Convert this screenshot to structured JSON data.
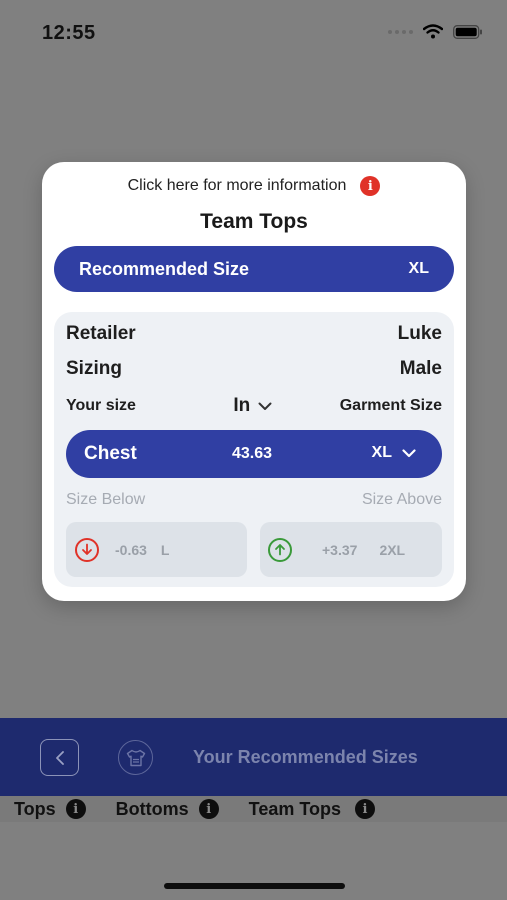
{
  "status_bar": {
    "time": "12:55"
  },
  "modal": {
    "more_info_text": "Click here for more information",
    "title": "Team Tops",
    "recommended": {
      "label": "Recommended Size",
      "value": "XL"
    },
    "retailer": {
      "label": "Retailer",
      "value": "Luke"
    },
    "sizing": {
      "label": "Sizing",
      "value": "Male"
    },
    "your_size_label": "Your size",
    "unit": "In",
    "garment_size_label": "Garment Size",
    "measurement": {
      "label": "Chest",
      "value": "43.63",
      "size": "XL"
    },
    "size_below": {
      "label": "Size Below",
      "diff": "-0.63",
      "size": "L"
    },
    "size_above": {
      "label": "Size Above",
      "diff": "+3.37",
      "size": "2XL"
    }
  },
  "app_bar": {
    "title": "Your Recommended Sizes"
  },
  "tabs": [
    {
      "label": "Tops"
    },
    {
      "label": "Bottoms"
    },
    {
      "label": "Team Tops"
    }
  ],
  "icons": {
    "info": "i",
    "back": "chevron-left-icon",
    "shirt": "shirt-icon",
    "arrow_down": "arrow-down-circle-icon",
    "arrow_up": "arrow-up-circle-icon"
  },
  "colors": {
    "primary": "#303fa3",
    "app_bar": "#1e2a6e",
    "info_red": "#e03228",
    "up_green": "#3a9a3a",
    "panel": "#eef1f5"
  }
}
